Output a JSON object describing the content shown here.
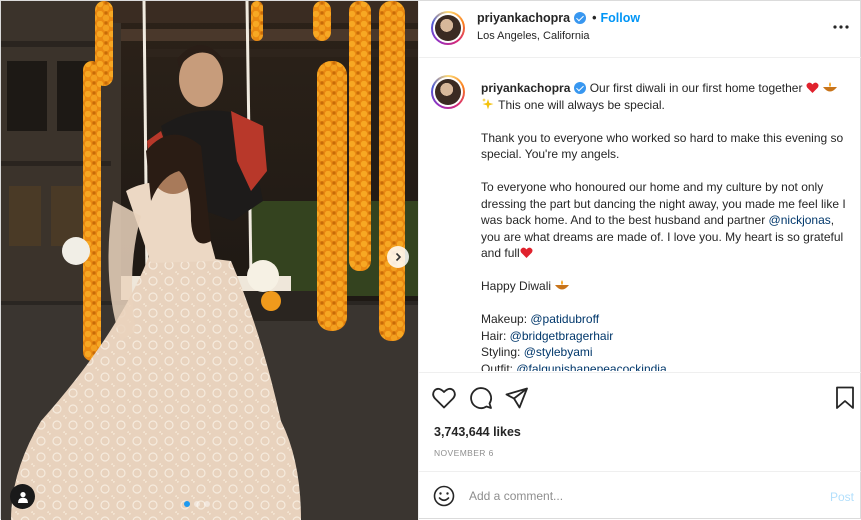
{
  "post": {
    "username": "priyankachopra",
    "follow_label": "Follow",
    "separator": "•",
    "location": "Los Angeles, California",
    "more_label": "•••"
  },
  "caption": {
    "line1": "Our first diwali in our first home together",
    "line1_tail": "This one will always be special.",
    "p2": "Thank you to everyone who worked so hard to make this evening so special. You're my angels.",
    "p3_a": "To everyone who honoured our home and my culture by not only dressing the part but dancing the night away, you made me feel like I was back home. And to the best husband and partner",
    "p3_link": "@nickjonas",
    "p3_b": ", you are what dreams are made of. I love you. My heart is so grateful and full",
    "p4": "Happy Diwali",
    "credits": [
      {
        "label": "Makeup: ",
        "handle": "@patidubroff"
      },
      {
        "label": "Hair: ",
        "handle": "@bridgetbragerhair"
      },
      {
        "label": "Styling: ",
        "handle": "@stylebyami"
      },
      {
        "label": "Outfit: ",
        "handle": "@falgunishanepeacockindia"
      }
    ]
  },
  "stats": {
    "likes": "3,743,644 likes",
    "date": "NOVEMBER 6"
  },
  "comment": {
    "placeholder": "Add a comment...",
    "post_label": "Post"
  },
  "icons": {
    "like": "heart-icon",
    "comment": "comment-icon",
    "share": "share-icon",
    "save": "bookmark-icon",
    "emoji": "smiley-icon",
    "next": "chevron-right-icon",
    "tags": "user-tag-icon"
  },
  "colors": {
    "accent": "#0095f6",
    "verified": "#3897f0",
    "post_disabled": "#b2dffc",
    "marigold": "#f09a1c"
  }
}
